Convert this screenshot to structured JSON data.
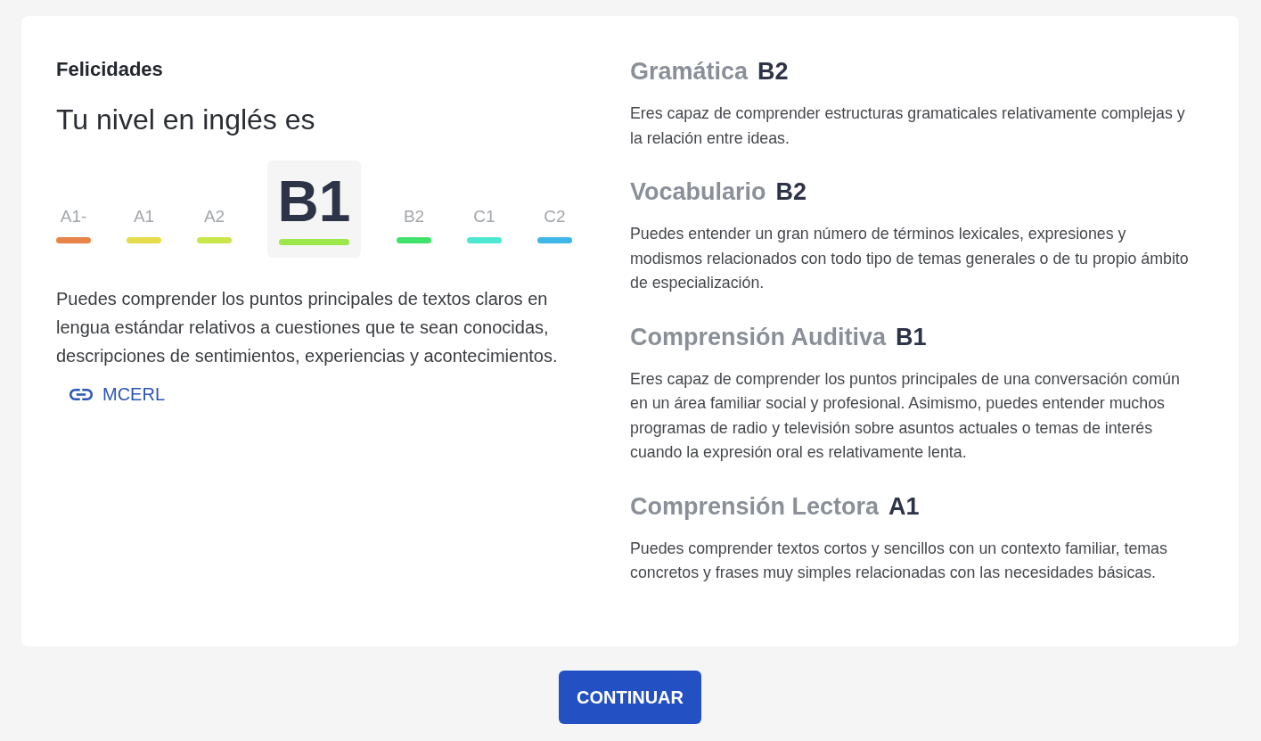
{
  "result": {
    "greeting": "Felicidades",
    "title": "Tu nivel en inglés es",
    "levels": [
      {
        "label": "A1-",
        "color": "#e8834a",
        "selected": false
      },
      {
        "label": "A1",
        "color": "#e6dc4a",
        "selected": false
      },
      {
        "label": "A2",
        "color": "#c9e64a",
        "selected": false
      },
      {
        "label": "B1",
        "color": "#9ce84a",
        "selected": true
      },
      {
        "label": "B2",
        "color": "#3fe36a",
        "selected": false
      },
      {
        "label": "C1",
        "color": "#4de8d2",
        "selected": false
      },
      {
        "label": "C2",
        "color": "#3fb6e8",
        "selected": false
      }
    ],
    "description": "Puedes comprender los puntos principales de textos claros en lengua estándar relativos a cuestiones que te sean conocidas, descripciones de sentimientos, experiencias y acontecimientos.",
    "link": {
      "label": "MCERL"
    }
  },
  "skills": [
    {
      "name": "Gramática",
      "grade": "B2",
      "description": "Eres capaz de comprender estructuras gramaticales relativamente complejas y la relación entre ideas."
    },
    {
      "name": "Vocabulario",
      "grade": "B2",
      "description": "Puedes entender un gran número de términos lexicales, expresiones y modismos relacionados con todo tipo de temas generales o de tu propio ámbito de especialización."
    },
    {
      "name": "Comprensión Auditiva",
      "grade": "B1",
      "description": "Eres capaz de comprender los puntos principales de una conversación común en un área familiar social y profesional. Asimismo, puedes entender muchos programas de radio y televisión sobre asuntos actuales o temas de interés cuando la expresión oral es relativamente lenta."
    },
    {
      "name": "Comprensión Lectora",
      "grade": "A1",
      "description": "Puedes comprender textos cortos y sencillos con un contexto familiar, temas concretos y frases muy simples relacionadas con las necesidades básicas."
    }
  ],
  "continue_button": "CONTINUAR"
}
